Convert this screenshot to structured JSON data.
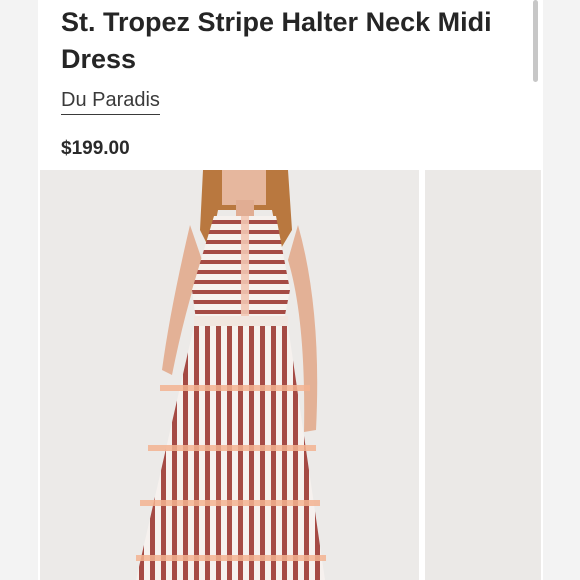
{
  "product": {
    "title": "St. Tropez Stripe Halter Neck Midi Dress",
    "brand": "Du Paradis",
    "price": "$199.00"
  },
  "images": [
    {
      "alt": "model-wearing-striped-halter-dress"
    },
    {
      "alt": "next-product-image"
    }
  ]
}
